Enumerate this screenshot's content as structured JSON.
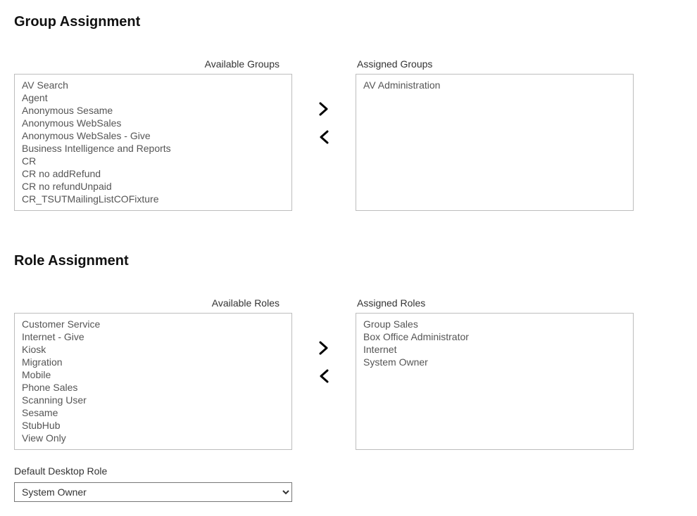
{
  "group_assignment": {
    "heading": "Group Assignment",
    "available": {
      "label": "Available Groups",
      "items": [
        "AV Search",
        "Agent",
        "Anonymous Sesame",
        "Anonymous WebSales",
        "Anonymous WebSales - Give",
        "Business Intelligence and Reports",
        "CR",
        "CR no addRefund",
        "CR no refundUnpaid",
        "CR_TSUTMailingListCOFixture"
      ]
    },
    "assigned": {
      "label": "Assigned Groups",
      "items": [
        "AV Administration"
      ]
    }
  },
  "role_assignment": {
    "heading": "Role Assignment",
    "available": {
      "label": "Available Roles",
      "items": [
        "Customer Service",
        "Internet - Give",
        "Kiosk",
        "Migration",
        "Mobile",
        "Phone Sales",
        "Scanning User",
        "Sesame",
        "StubHub",
        "View Only"
      ]
    },
    "assigned": {
      "label": "Assigned Roles",
      "items": [
        "Group Sales",
        "Box Office Administrator",
        "Internet",
        "System Owner"
      ]
    }
  },
  "default_desktop_role": {
    "label": "Default Desktop Role",
    "selected": "System Owner",
    "options": [
      "System Owner"
    ]
  }
}
